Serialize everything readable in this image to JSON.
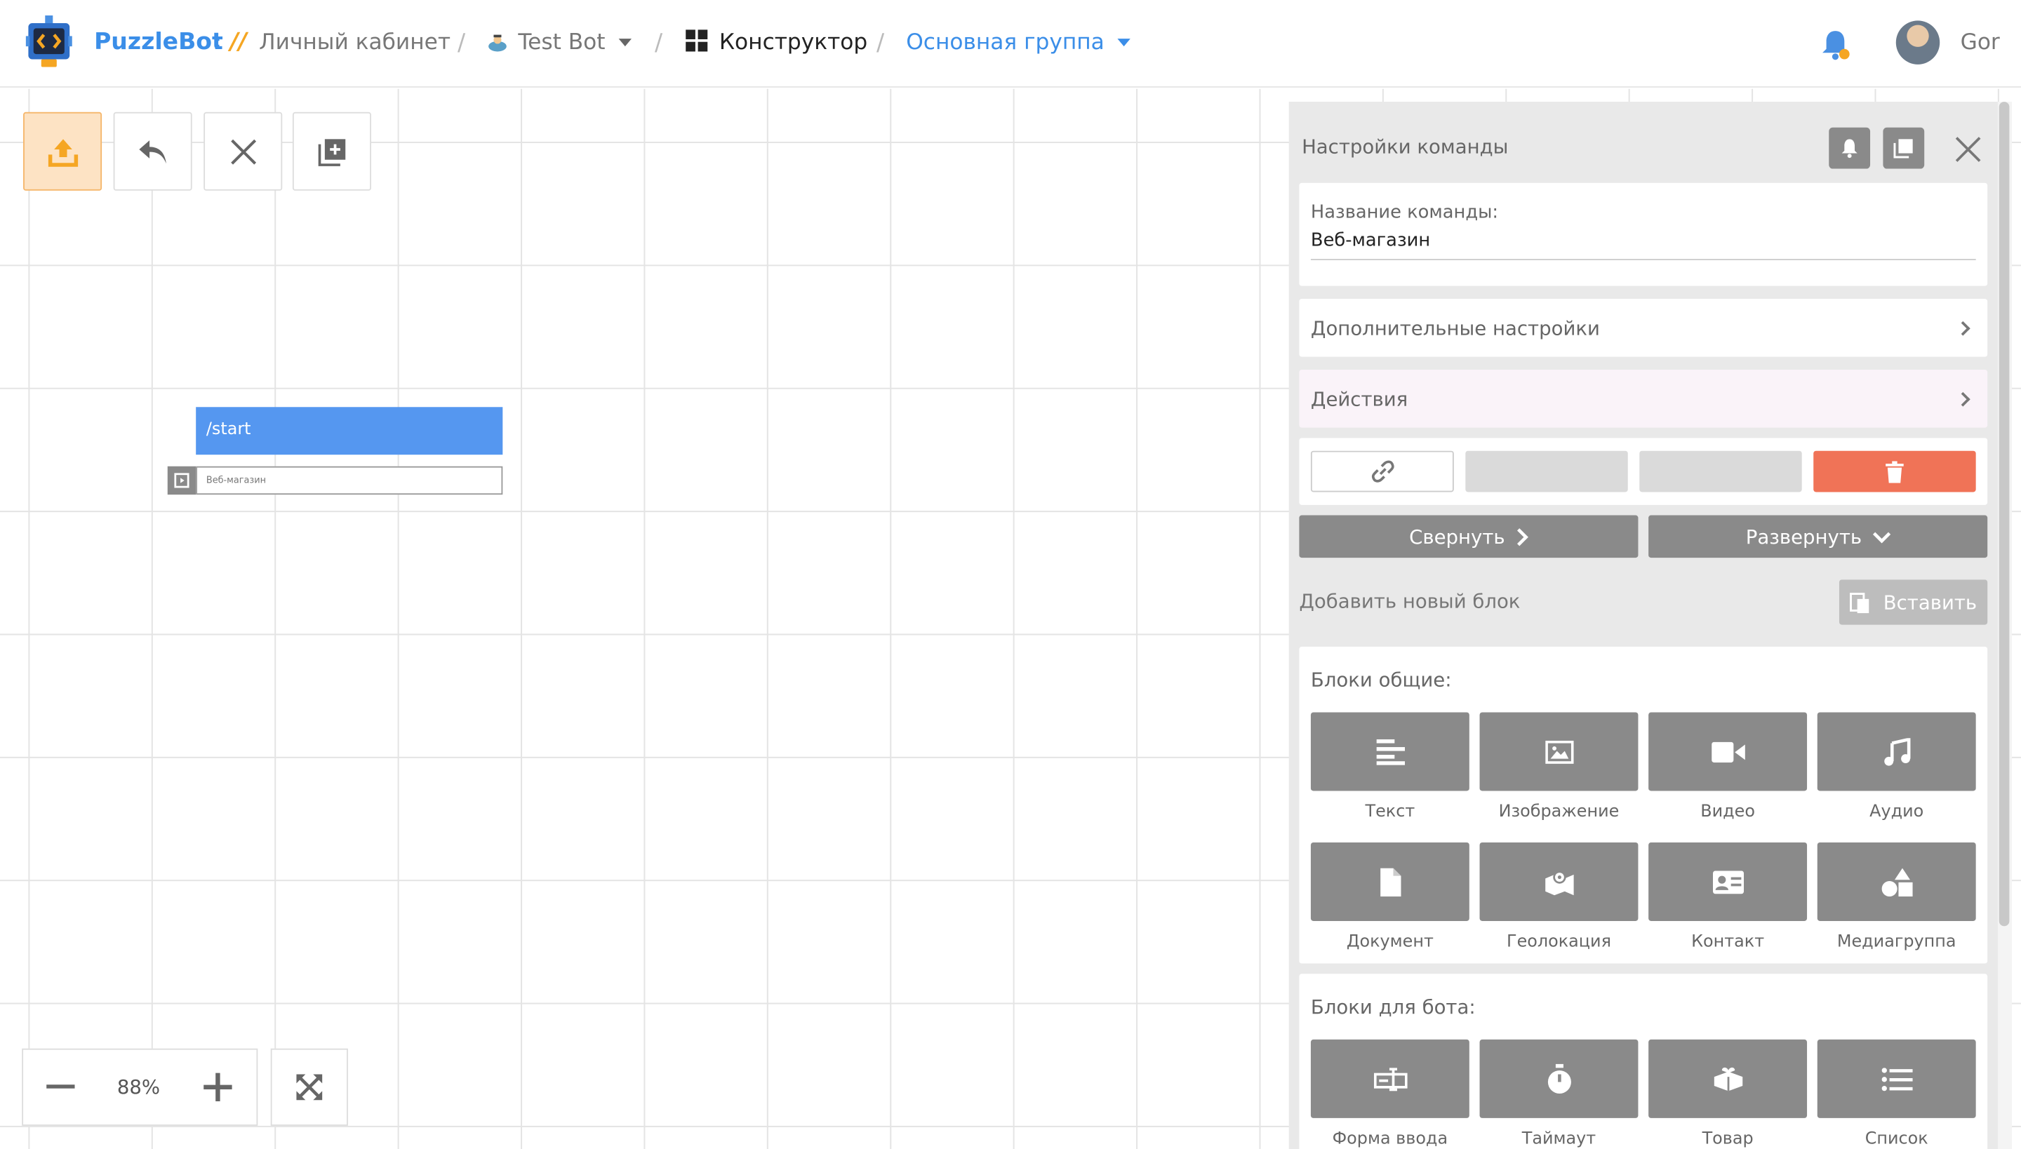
{
  "header": {
    "brand": "PuzzleBot",
    "brand_sep": ":",
    "brand_slashes": "//",
    "crumb_cabinet": "Личный кабинет",
    "crumb_bot": "Test Bot",
    "crumb_constructor": "Конструктор",
    "crumb_group": "Основная группа",
    "username": "Gor"
  },
  "canvas": {
    "node_command": "/start",
    "node_sub": "Веб-магазин",
    "zoom": "88%"
  },
  "panel": {
    "title": "Настройки команды",
    "name_label": "Название команды:",
    "name_value": "Веб-магазин",
    "extra_settings": "Дополнительные настройки",
    "actions": "Действия",
    "collapse": "Свернуть",
    "expand": "Развернуть",
    "add_block": "Добавить новый блок",
    "paste": "Вставить",
    "blocks_general_title": "Блоки общие:",
    "blocks_general": [
      "Текст",
      "Изображение",
      "Видео",
      "Аудио",
      "Документ",
      "Геолокация",
      "Контакт",
      "Медиагруппа"
    ],
    "blocks_bot_title": "Блоки для бота:",
    "blocks_bot": [
      "Форма ввода",
      "Таймаут",
      "Товар",
      "Список"
    ]
  },
  "colors": {
    "brand_blue": "#3b8ee8",
    "accent_orange": "#f5a623",
    "delete_red": "#f07357",
    "node_blue": "#5597f0",
    "tile_gray": "#8a8a8a"
  },
  "icons": {
    "upload": "upload-icon",
    "undo": "undo-icon",
    "close": "close-icon",
    "add": "add-copy-icon",
    "bell": "bell-icon",
    "copy": "copy-icon",
    "link": "link-icon",
    "trash": "trash-icon"
  }
}
